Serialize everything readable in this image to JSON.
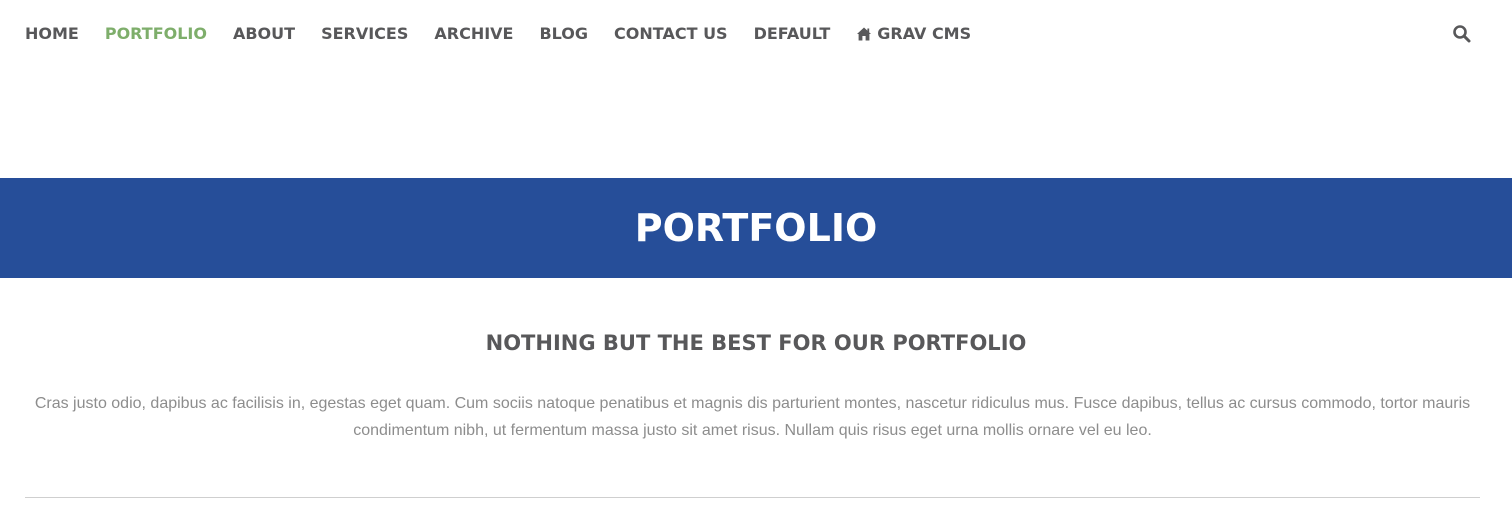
{
  "nav": {
    "items": [
      {
        "label": "HOME",
        "active": false
      },
      {
        "label": "PORTFOLIO",
        "active": true
      },
      {
        "label": "ABOUT",
        "active": false
      },
      {
        "label": "SERVICES",
        "active": false
      },
      {
        "label": "ARCHIVE",
        "active": false
      },
      {
        "label": "BLOG",
        "active": false
      },
      {
        "label": "CONTACT US",
        "active": false
      },
      {
        "label": "DEFAULT",
        "active": false
      },
      {
        "label": "GRAV CMS",
        "active": false,
        "icon": "home-icon"
      }
    ],
    "search_icon": "search-icon"
  },
  "hero": {
    "title": "PORTFOLIO",
    "background_color": "#264e99"
  },
  "section": {
    "heading": "NOTHING BUT THE BEST FOR OUR PORTFOLIO",
    "body": "Cras justo odio, dapibus ac facilisis in, egestas eget quam. Cum sociis natoque penatibus et magnis dis parturient montes, nascetur ridiculus mus. Fusce dapibus, tellus ac cursus commodo, tortor mauris condimentum nibh, ut fermentum massa justo sit amet risus. Nullam quis risus eget urna mollis ornare vel eu leo."
  },
  "colors": {
    "nav_text": "#58585a",
    "nav_active": "#7eae6b",
    "body_text": "#8d8d8d"
  }
}
